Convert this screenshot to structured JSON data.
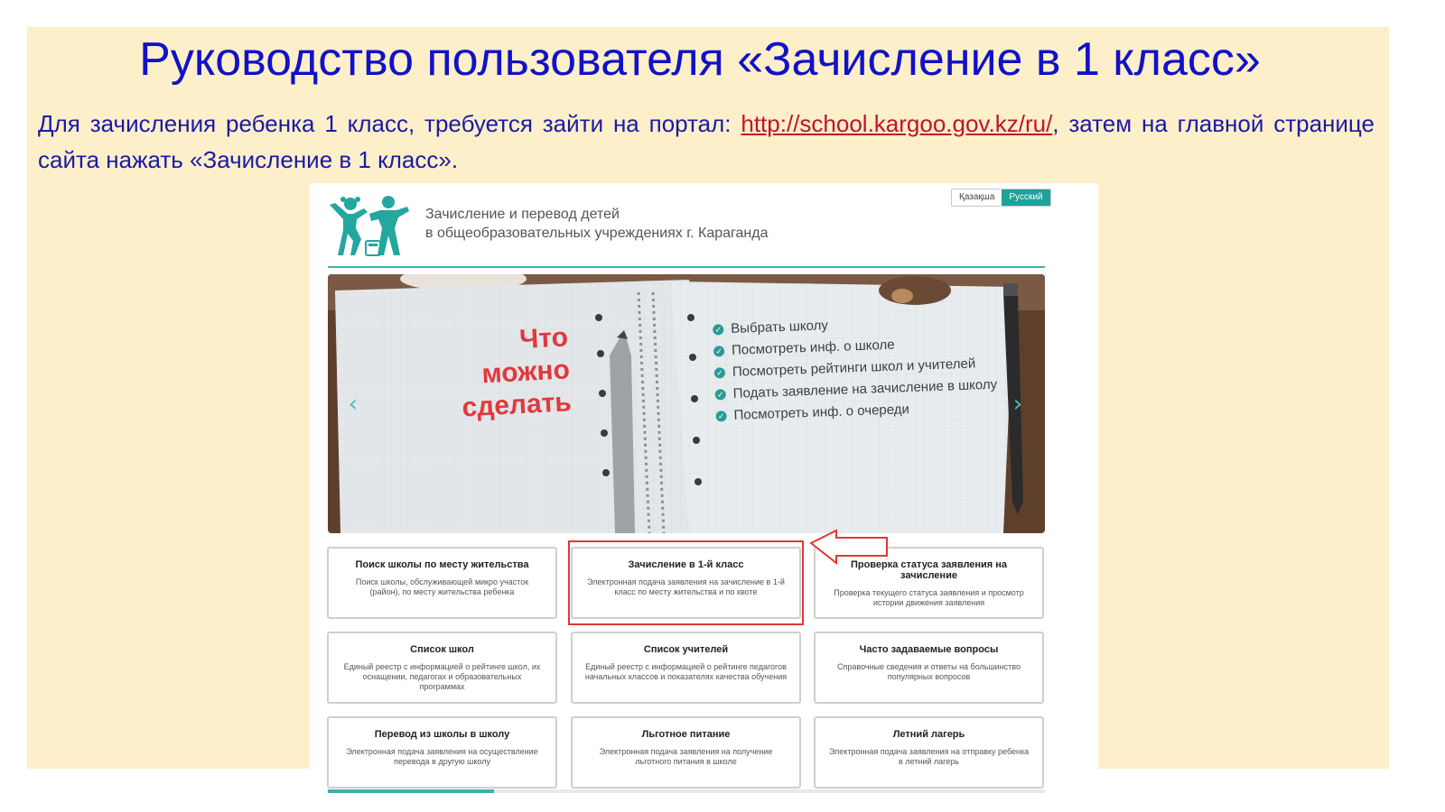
{
  "slide": {
    "title": "Руководство пользователя «Зачисление в 1 класс»",
    "text_before": "Для зачисления ребенка 1 класс, требуется зайти на портал: ",
    "link": "http://school.kargoo.gov.kz/ru/",
    "text_after": ", затем на главной странице сайта нажать «Зачисление в 1 класс»."
  },
  "site": {
    "title_line1": "Зачисление и перевод детей",
    "title_line2": "в общеобразовательных учреждениях г. Караганда",
    "lang": [
      "Қазақша",
      "Русский"
    ],
    "lang_active": "Русский"
  },
  "banner": {
    "heading": [
      "Что",
      "можно",
      "сделать"
    ],
    "items": [
      "Выбрать школу",
      "Посмотреть инф. о школе",
      "Посмотреть рейтинги школ и учителей",
      "Подать заявление на зачисление в школу",
      "Посмотреть инф. о очереди"
    ],
    "prev_icon": "chevron-left-icon",
    "next_icon": "chevron-right-icon"
  },
  "cards": [
    {
      "title": "Поиск школы по месту жительства",
      "desc": "Поиск школы, обслуживающей микро участок (район), по месту жительства ребенка"
    },
    {
      "title": "Зачисление в 1-й класс",
      "desc": "Электронная подача заявления на зачисление в 1-й класс по месту жительства и по квоте"
    },
    {
      "title": "Проверка статуса заявления на зачисление",
      "desc": "Проверка текущего статуса заявления и просмотр истории движения заявления"
    },
    {
      "title": "Список школ",
      "desc": "Единый реестр с информацией о рейтинге школ, их оснащении, педагогах и образовательных программах"
    },
    {
      "title": "Список учителей",
      "desc": "Единый реестр с информацией о рейтинге педагогов начальных классов и показателях качества обучения"
    },
    {
      "title": "Часто задаваемые вопросы",
      "desc": "Справочные сведения и ответы на большинство популярных вопросов"
    },
    {
      "title": "Перевод из школы в школу",
      "desc": "Электронная подача заявления на осуществление перевода в другую школу"
    },
    {
      "title": "Льготное питание",
      "desc": "Электронная подача заявления на получение льготного питания в школе"
    },
    {
      "title": "Летний лагерь",
      "desc": "Электронная подача заявления на отправку ребенка в летний лагерь"
    }
  ],
  "colors": {
    "title": "#1111c8",
    "body_text": "#1a1aa8",
    "link": "#c0142e",
    "accent": "#20a19a",
    "highlight": "#e53535",
    "slide_bg": "#fdefc9"
  }
}
